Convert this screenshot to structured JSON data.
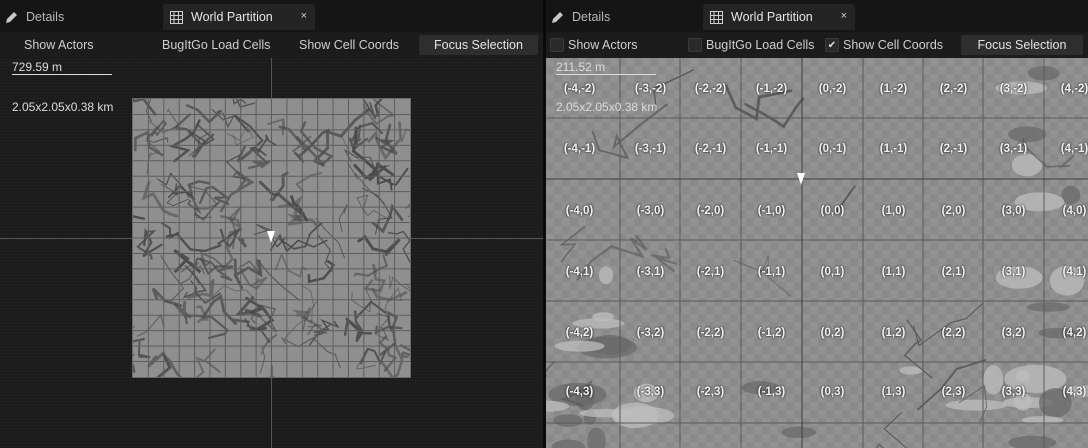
{
  "colors": {
    "background": "#1a1a1a",
    "tab_active": "#242424",
    "terrain": "#8d8d8d",
    "grid_line": "#5c5c5c",
    "label": "#f2f2f2"
  },
  "left_panel": {
    "tabs": [
      {
        "label": "Details",
        "icon": "pencil-icon"
      },
      {
        "label": "World Partition",
        "icon": "world-partition-icon",
        "close": "×"
      }
    ],
    "toolbar": {
      "show_actors": "Show Actors",
      "bugitgo_load_cells": "BugItGo Load Cells",
      "show_cell_coords": "Show Cell Coords",
      "focus_selection": "Focus Selection"
    },
    "scale_label": "729.59 m",
    "dimensions_label": "2.05x2.05x0.38 km"
  },
  "right_panel": {
    "tabs": [
      {
        "label": "Details",
        "icon": "pencil-icon"
      },
      {
        "label": "World Partition",
        "icon": "world-partition-icon",
        "close": "×"
      }
    ],
    "toolbar": {
      "show_actors": "Show Actors",
      "show_actors_checked": false,
      "bugitgo_load_cells": "BugItGo Load Cells",
      "bugitgo_load_cells_checked": false,
      "show_cell_coords": "Show Cell Coords",
      "show_cell_coords_checked": true,
      "check_glyph": "✔",
      "focus_selection": "Focus Selection"
    },
    "scale_label": "211.52 m",
    "dimensions_label": "2.05x2.05x0.38 km",
    "cell_rows": [
      [
        "(-4,-2)",
        "(-3,-2)",
        "(-2,-2)",
        "(-1,-2)",
        "(0,-2)",
        "(1,-2)",
        "(2,-2)",
        "(3,-2)",
        "(4,-2)"
      ],
      [
        "(-4,-1)",
        "(-3,-1)",
        "(-2,-1)",
        "(-1,-1)",
        "(0,-1)",
        "(1,-1)",
        "(2,-1)",
        "(3,-1)",
        "(4,-1)"
      ],
      [
        "(-4,0)",
        "(-3,0)",
        "(-2,0)",
        "(-1,0)",
        "(0,0)",
        "(1,0)",
        "(2,0)",
        "(3,0)",
        "(4,0)"
      ],
      [
        "(-4,1)",
        "(-3,1)",
        "(-2,1)",
        "(-1,1)",
        "(0,1)",
        "(1,1)",
        "(2,1)",
        "(3,1)",
        "(4,1)"
      ],
      [
        "(-4,2)",
        "(-3,2)",
        "(-2,2)",
        "(-1,2)",
        "(0,2)",
        "(1,2)",
        "(2,2)",
        "(3,2)",
        "(4,2)"
      ],
      [
        "(-4,3)",
        "(-3,3)",
        "(-2,3)",
        "(-1,3)",
        "(0,3)",
        "(1,3)",
        "(2,3)",
        "(3,3)",
        "(4,3)"
      ]
    ]
  }
}
